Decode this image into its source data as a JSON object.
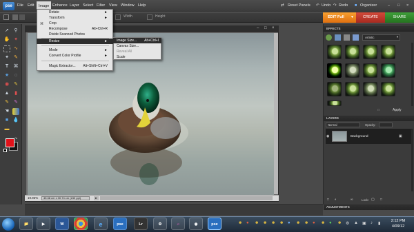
{
  "menubar": {
    "logo": "pse",
    "items": [
      "File",
      "Edit",
      "Image",
      "Enhance",
      "Layer",
      "Select",
      "Filter",
      "View",
      "Window",
      "Help"
    ],
    "active_item": "Image",
    "right": {
      "reset_panels": "Reset Panels",
      "undo": "Undo",
      "redo": "Redo",
      "organizer": "Organizer"
    }
  },
  "optionsbar": {
    "width_label": "Width",
    "height_label": "Height"
  },
  "workspace_tabs": {
    "edit": "EDIT Full",
    "create": "CREATE",
    "share": "SHARE"
  },
  "image_menu": {
    "items": [
      {
        "label": "Rotate",
        "shortcut": "",
        "disabled": false,
        "submenu": true
      },
      {
        "label": "Transform",
        "shortcut": "",
        "disabled": false,
        "submenu": true
      },
      {
        "label": "Crop",
        "shortcut": "",
        "disabled": false,
        "submenu": false
      },
      {
        "label": "Recompose",
        "shortcut": "Alt+Ctrl+R",
        "disabled": false,
        "submenu": false
      },
      {
        "label": "Divide Scanned Photos",
        "shortcut": "",
        "disabled": false,
        "submenu": false
      },
      {
        "label": "Resize",
        "shortcut": "",
        "disabled": false,
        "submenu": true,
        "highlighted": true
      },
      {
        "label": "Mode",
        "shortcut": "",
        "disabled": false,
        "submenu": true
      },
      {
        "label": "Convert Color Profile",
        "shortcut": "",
        "disabled": false,
        "submenu": true
      },
      {
        "label": "Magic Extractor...",
        "shortcut": "Alt+Shift+Ctrl+V",
        "disabled": false,
        "submenu": false
      }
    ]
  },
  "resize_submenu": {
    "items": [
      {
        "label": "Image Size...",
        "shortcut": "Alt+Ctrl+I",
        "highlighted": true,
        "disabled": false
      },
      {
        "label": "Canvas Size...",
        "shortcut": "",
        "highlighted": false,
        "disabled": false
      },
      {
        "label": "Reveal All",
        "shortcut": "",
        "highlighted": false,
        "disabled": true
      },
      {
        "label": "Scale",
        "shortcut": "",
        "highlighted": false,
        "disabled": false
      }
    ]
  },
  "document": {
    "zoom": "19.93%",
    "dimensions": "45.38 cm x 30.74 cm (240 ppi)"
  },
  "effects_panel": {
    "title": "EFFECTS",
    "filter_select": "Artistic",
    "apply_label": "Apply"
  },
  "layers_panel": {
    "title": "LAYERS",
    "blend_mode": "Normal",
    "opacity_label": "Opacity:",
    "layer_name": "Background",
    "lock_label": "Lock:"
  },
  "adjustments_panel": {
    "title": "ADJUSTMENTS"
  },
  "taskbar": {
    "time": "2:12 PM",
    "date": "4/09/12",
    "apps": [
      "folder",
      "film",
      "word",
      "chrome",
      "ie",
      "pse",
      "lr",
      "vlc",
      "itunes",
      "photos",
      "pse2"
    ]
  },
  "colors": {
    "foreground": "#e0121a",
    "background": "#111111",
    "edit_tab": "#f08020",
    "create_tab": "#c03a2c",
    "share_tab": "#339030"
  }
}
